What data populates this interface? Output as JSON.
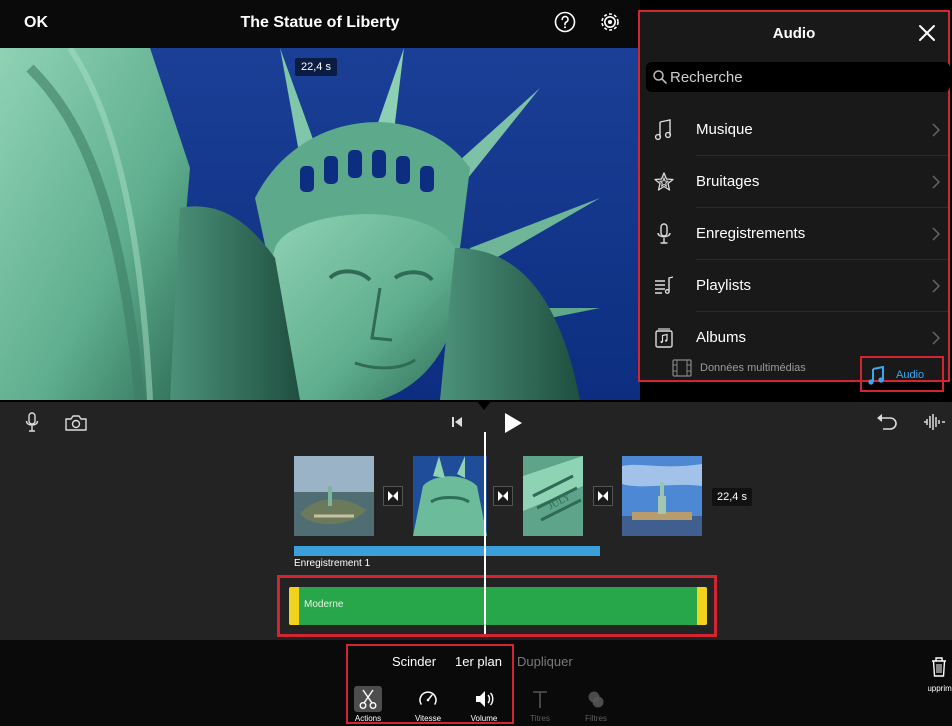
{
  "topbar": {
    "ok_label": "OK",
    "project_title": "The Statue of Liberty",
    "help_icon": "question-circle-icon",
    "settings_icon": "gear-icon"
  },
  "preview": {
    "time_badge": "22,4 s"
  },
  "audio_panel": {
    "title": "Audio",
    "close_icon": "close-icon",
    "search": {
      "placeholder": "Recherche"
    },
    "items": [
      {
        "label": "Musique",
        "icon": "music-note-icon"
      },
      {
        "label": "Bruitages",
        "icon": "sound-effects-icon"
      },
      {
        "label": "Enregistrements",
        "icon": "microphone-icon"
      },
      {
        "label": "Playlists",
        "icon": "playlist-icon"
      },
      {
        "label": "Albums",
        "icon": "album-icon"
      }
    ],
    "tabs": {
      "media_label": "Données multimédias",
      "audio_label": "Audio",
      "selected": "Audio"
    }
  },
  "timeline": {
    "clip_duration": "22,4 s",
    "recording_label": "Enregistrement 1",
    "music_label": "Moderne"
  },
  "toolbar": {
    "split_label": "Scinder",
    "foreground_label": "1er plan",
    "duplicate_label": "Dupliquer",
    "tools": [
      {
        "label": "Actions",
        "icon": "scissors-icon",
        "selected": true
      },
      {
        "label": "Vitesse",
        "icon": "speedometer-icon"
      },
      {
        "label": "Volume",
        "icon": "speaker-icon"
      },
      {
        "label": "Titres",
        "icon": "text-icon",
        "disabled": true
      },
      {
        "label": "Filtres",
        "icon": "filters-icon",
        "disabled": true
      }
    ],
    "delete_label": "Supprimer"
  },
  "colors": {
    "highlight": "#d32431",
    "accent_blue": "#3ba7f0",
    "music_track": "#27a64a",
    "trim_handle": "#f2d31c",
    "recording_track": "#3ba0d9"
  }
}
